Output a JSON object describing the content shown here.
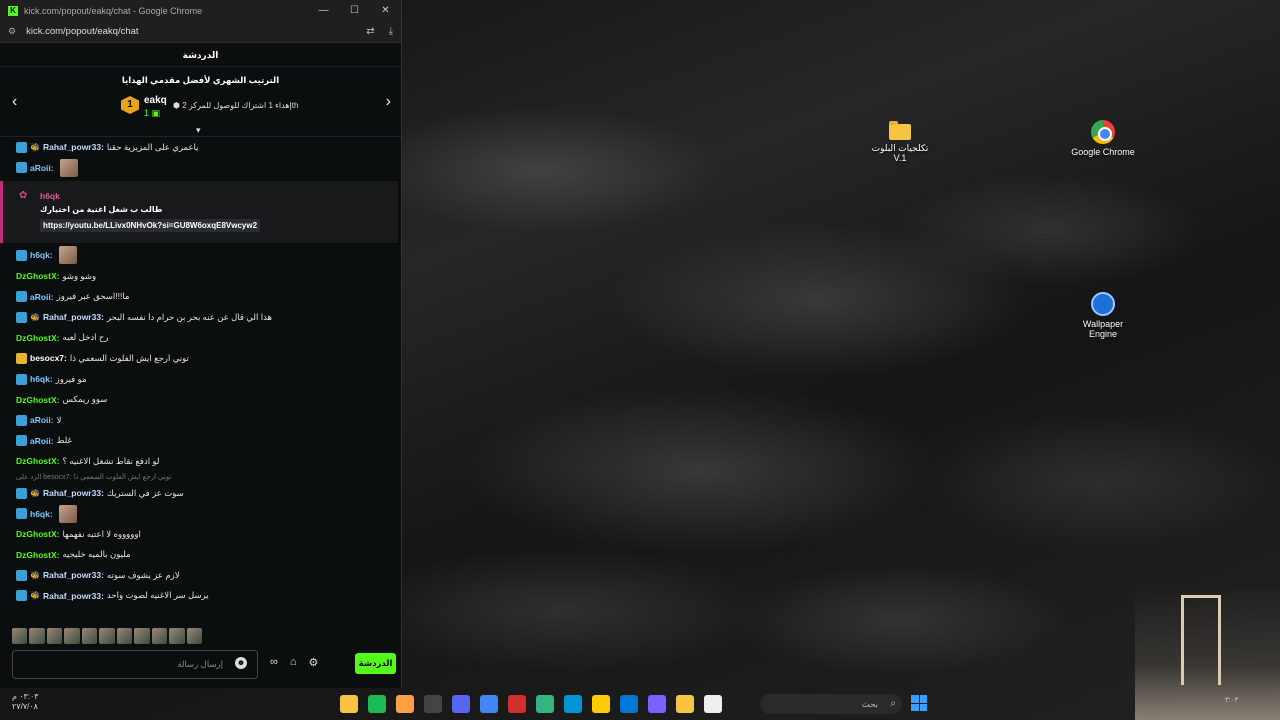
{
  "window": {
    "title": "kick.com/popout/eakq/chat - Google Chrome",
    "url": "kick.com/popout/eakq/chat",
    "controls": [
      "—",
      "☐",
      "✕"
    ]
  },
  "chat": {
    "header": "الدردشة",
    "leaderboard": {
      "title": "الترتيب الشهري لأفضل مقدمي الهدايا",
      "rank": "1",
      "user": "eakq",
      "count": "1",
      "goal": "إهداء 1 اشتراك للوصول للمركز 2",
      "goal_suffix": "th"
    },
    "pinned": {
      "user": "h6qk",
      "text": "طالب ب شغل اغنية من اختيارك",
      "link": "https://youtu.be/LLivx0NHvOk?si=GU8W6oxqE8Vwcyw2"
    },
    "messages": [
      {
        "user": "Rahaf_powr33",
        "badge": "sub",
        "tag": "🐝",
        "text": "ياعمري على المزيزية حقنا",
        "color": "#c6d9ff"
      },
      {
        "user": "aRoii",
        "badge": "sub",
        "tag": "",
        "text": "",
        "color": "#7ec8ff",
        "avatar": true
      },
      {
        "user": "h6qk",
        "badge": "sub",
        "tag": "",
        "text": "",
        "color": "#7ec8ff",
        "avatar": true
      },
      {
        "user": "DzGhostX",
        "badge": "",
        "tag": "",
        "text": "وشو وشو",
        "color": "#53fc18"
      },
      {
        "user": "aRoii",
        "badge": "sub",
        "tag": "",
        "text": "ما!!!اسحق عبر فيروز",
        "color": "#7ec8ff"
      },
      {
        "user": "Rahaf_powr33",
        "badge": "sub",
        "tag": "🐝",
        "text": "هذا الي قال عن عنه بحر بن حرام دا نفسه البحر",
        "color": "#c6d9ff"
      },
      {
        "user": "DzGhostX",
        "badge": "",
        "tag": "",
        "text": "رح ادخل لعبه",
        "color": "#53fc18"
      },
      {
        "user": "besocx7",
        "badge": "gift",
        "tag": "",
        "text": "توني ارجع ايش الفلوت السعمي ذا",
        "color": "#ffffff"
      },
      {
        "user": "h6qk",
        "badge": "sub",
        "tag": "",
        "text": "مو فيروز",
        "color": "#7ec8ff"
      },
      {
        "user": "DzGhostX",
        "badge": "",
        "tag": "",
        "text": "سوو ريمكس",
        "color": "#53fc18"
      },
      {
        "user": "aRoii",
        "badge": "sub",
        "tag": "",
        "text": "لا",
        "color": "#7ec8ff"
      },
      {
        "user": "aRoii",
        "badge": "sub",
        "tag": "",
        "text": "غلط",
        "color": "#7ec8ff"
      },
      {
        "user": "DzGhostX",
        "badge": "",
        "tag": "",
        "text": "لو ادفع نقاط تشغل الاغنيه ؟",
        "color": "#53fc18"
      }
    ],
    "reply_hint": "الرد على besocx7: توني ارجع ايش الفلوت السعمي ذا",
    "messages2": [
      {
        "user": "Rahaf_powr33",
        "badge": "sub",
        "tag": "🐝",
        "text": "سوت عز في الستريك",
        "color": "#c6d9ff"
      },
      {
        "user": "h6qk",
        "badge": "sub",
        "tag": "",
        "text": "",
        "color": "#7ec8ff",
        "avatar": true
      },
      {
        "user": "DzGhostX",
        "badge": "",
        "tag": "",
        "text": "اوووووه لا اعتبه نفهمها",
        "color": "#53fc18"
      },
      {
        "user": "DzGhostX",
        "badge": "",
        "tag": "",
        "text": "مليون بالميه خليجيه",
        "color": "#53fc18"
      },
      {
        "user": "Rahaf_powr33",
        "badge": "sub",
        "tag": "🐝",
        "text": "لازم عز يشوف سوته",
        "color": "#c6d9ff"
      },
      {
        "user": "Rahaf_powr33",
        "badge": "sub",
        "tag": "🐝",
        "text": "يرسل سر الاغنيه لصوت واحد",
        "color": "#c6d9ff"
      }
    ],
    "input_placeholder": "إرسال رسالة",
    "send_button": "الدردشة"
  },
  "desktop": {
    "icons": [
      {
        "label": "تكلجيات البلوت V.1",
        "kind": "folder"
      },
      {
        "label": "Google Chrome",
        "kind": "chrome"
      },
      {
        "label": "Wallpaper Engine",
        "kind": "we"
      }
    ]
  },
  "taskbar": {
    "clock_time": "٠٣:٠٣ م",
    "clock_date": "٢٧/٧/٠٨",
    "search_placeholder": "بحث",
    "apps": [
      "#f5c542",
      "#1db954",
      "#ff9f43",
      "#444",
      "#5865f2",
      "#4285f4",
      "#d32f2f",
      "#36b37e",
      "#0096d6",
      "#ffcc00",
      "#0078d4",
      "#7b61ff",
      "#f5c542",
      "#eeeeee"
    ],
    "tray_time": "٣:٠٣"
  }
}
